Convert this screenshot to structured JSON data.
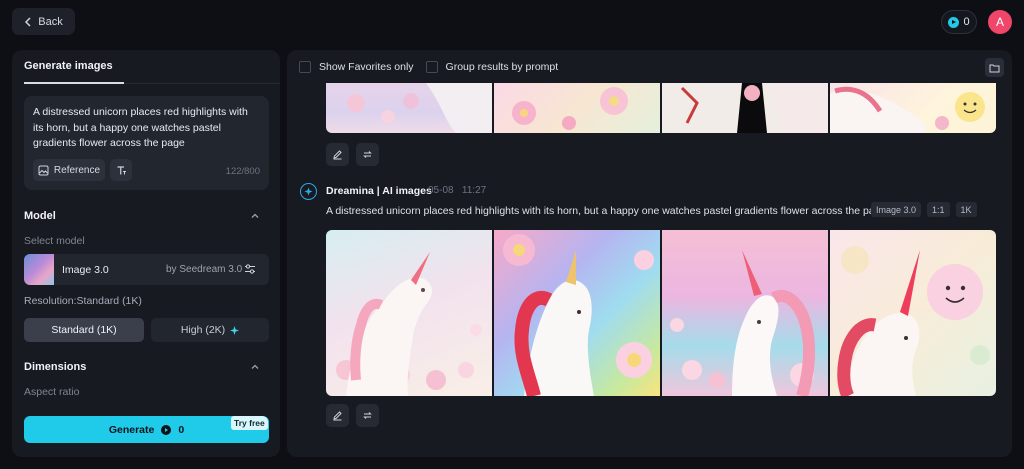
{
  "topbar": {
    "back_label": "Back",
    "credits": "0",
    "avatar_initial": "A"
  },
  "left": {
    "tab_label": "Generate images",
    "prompt_text": " A distressed unicorn places red highlights with its horn, but a happy one watches pastel gradients flower across the page",
    "reference_label": "Reference",
    "char_count": "122/800",
    "model_section": "Model",
    "select_model_label": "Select model",
    "model_name": "Image 3.0",
    "model_by": "by Seedream 3.0",
    "resolution_label": "Resolution:Standard (1K)",
    "res_standard": "Standard (1K)",
    "res_high": "High (2K)",
    "dimensions_section": "Dimensions",
    "aspect_ratio_label": "Aspect ratio",
    "generate_label": "Generate",
    "generate_cost": "0",
    "try_free_label": "Try free"
  },
  "right": {
    "show_favorites_label": "Show Favorites only",
    "group_by_prompt_label": "Group results by prompt",
    "generation": {
      "author": "Dreamina | AI images",
      "date": "05-08",
      "time": "11:27",
      "prompt": "A distressed unicorn places red highlights with its horn, but a happy one watches pastel gradients flower across the page",
      "tags": [
        "Image 3.0",
        "1:1",
        "1K"
      ]
    }
  },
  "colors": {
    "accent": "#1fcbe8",
    "avatar": "#f0466a",
    "panel": "#171a21",
    "background": "#0d0f14"
  },
  "icons": [
    "chevron-left-icon",
    "credit-icon",
    "reference-image-icon",
    "text-format-icon",
    "chevron-up-icon",
    "settings-sliders-icon",
    "sparkle-icon",
    "folder-icon",
    "edit-icon",
    "regenerate-icon",
    "dreamina-logo-icon"
  ]
}
